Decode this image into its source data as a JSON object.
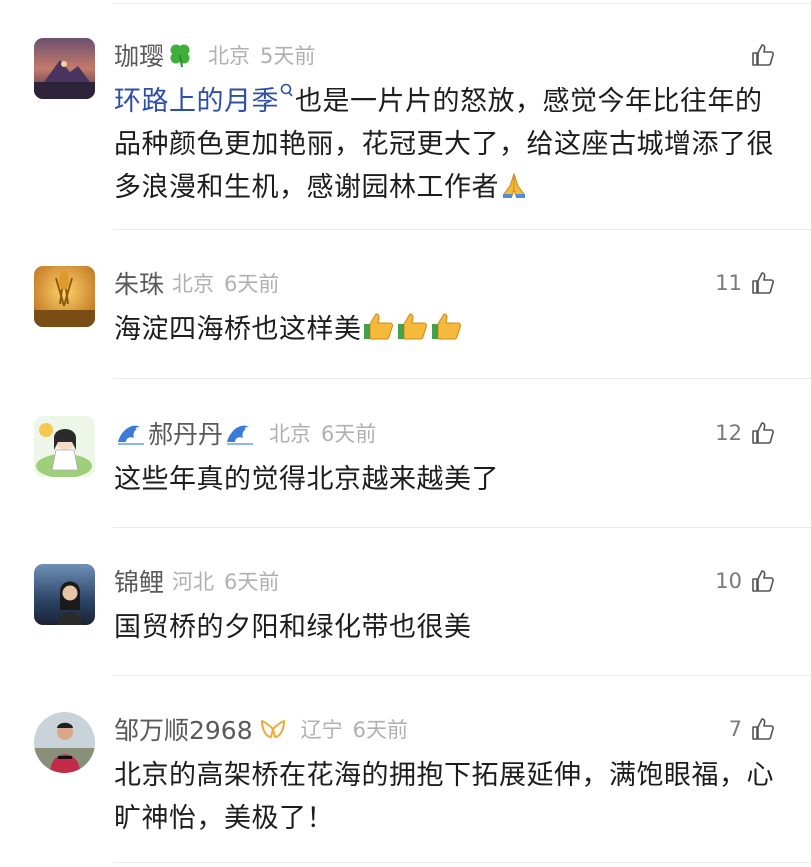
{
  "comments": [
    {
      "user": "珈璎",
      "badge": "clover-icon",
      "location": "北京",
      "time": "5天前",
      "likes": "",
      "topic_link": "环路上的月季",
      "text": "也是一片片的怒放，感觉今年比往年的品种颜色更加艳丽，花冠更大了，给这座古城增添了很多浪漫和生机，感谢园林工作者",
      "trailing_emoji": "folded-hands-icon"
    },
    {
      "user": "朱珠",
      "location": "北京",
      "time": "6天前",
      "likes": "11",
      "text": "海淀四海桥也这样美",
      "trailing_emoji": "thumbs-up-icon x3"
    },
    {
      "user": "郝丹丹",
      "badge": "wave-icon",
      "location": "北京",
      "time": "6天前",
      "likes": "12",
      "text": "这些年真的觉得北京越来越美了"
    },
    {
      "user": "锦鲤",
      "location": "河北",
      "time": "6天前",
      "likes": "10",
      "text": "国贸桥的夕阳和绿化带也很美"
    },
    {
      "user": "邹万顺2968",
      "badge": "vip-ribbon-icon",
      "location": "辽宁",
      "time": "6天前",
      "likes": "7",
      "text": "北京的高架桥在花海的拥抱下拓展延伸，满饱眼福，心旷神怡，美极了！"
    }
  ],
  "colors": {
    "name": "#5a5a5a",
    "meta": "#b0b0b0",
    "text": "#1d1d1d",
    "link": "#2d4fa8",
    "separator": "#e9e9e9"
  }
}
